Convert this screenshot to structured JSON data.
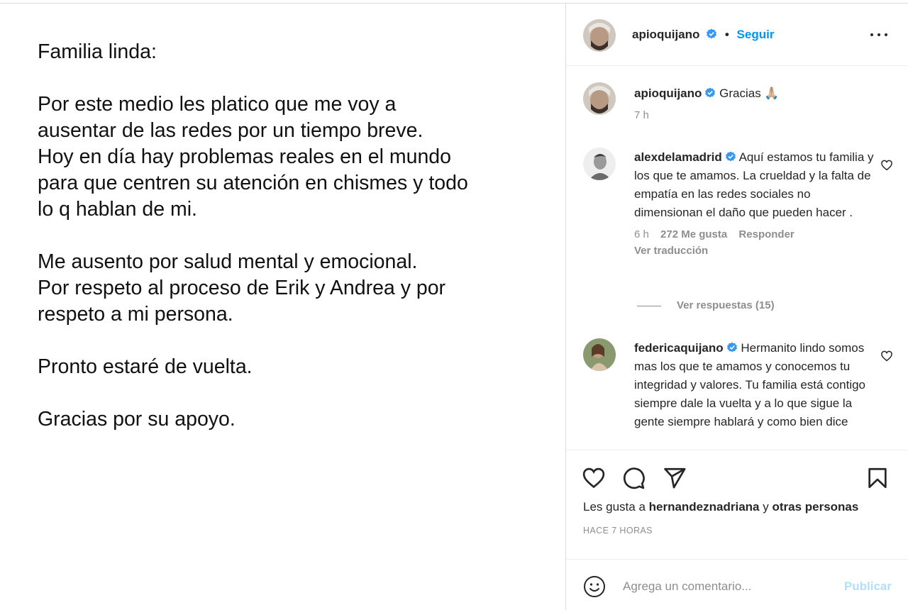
{
  "post": {
    "lines": [
      "Familia linda:",
      "Por este medio les platico que me voy a",
      "ausentar de las redes por un tiempo breve.",
      "Hoy en día hay problemas reales en el mundo",
      "para que centren su atención en chismes y todo",
      "lo q hablan de mi.",
      "Me ausento por salud mental y emocional.",
      "Por respeto al proceso de Erik y Andrea y por",
      "respeto a mi persona.",
      "Pronto estaré de vuelta.",
      "Gracias por su apoyo."
    ]
  },
  "header": {
    "username": "apioquijano",
    "separator": "•",
    "follow_label": "Seguir"
  },
  "comments": [
    {
      "username": "apioquijano",
      "text": "Gracias 🙏🏼",
      "time": "7 h"
    },
    {
      "username": "alexdelamadrid",
      "text": "Aquí estamos tu familia y los que te amamos. La crueldad y la falta de empatía en las redes sociales no dimensionan el daño que pueden hacer .",
      "time": "6 h",
      "likes": "272 Me gusta",
      "reply_label": "Responder",
      "translate_label": "Ver traducción"
    },
    {
      "username": "federicaquijano",
      "text": "Hermanito lindo somos mas los que te amamos y conocemos tu integridad y valores. Tu familia está contigo siempre dale la vuelta y a lo que sigue la gente siempre hablará y como bien dice"
    }
  ],
  "replies_label": "Ver respuestas (15)",
  "likes_line": {
    "prefix": "Les gusta a ",
    "user": "hernandeznadriana",
    "conj": " y ",
    "others": "otras personas"
  },
  "timestamp": "HACE 7 HORAS",
  "add_comment": {
    "placeholder": "Agrega un comentario...",
    "publish_label": "Publicar"
  },
  "colors": {
    "link_blue": "#0095f6",
    "publish_disabled": "#b2dffc",
    "muted": "#8e8e8e",
    "verified_blue": "#3897f0"
  },
  "icons": [
    "verified-badge-icon",
    "more-options-icon",
    "heart-icon",
    "comment-icon",
    "share-icon",
    "bookmark-icon",
    "emoji-icon"
  ]
}
